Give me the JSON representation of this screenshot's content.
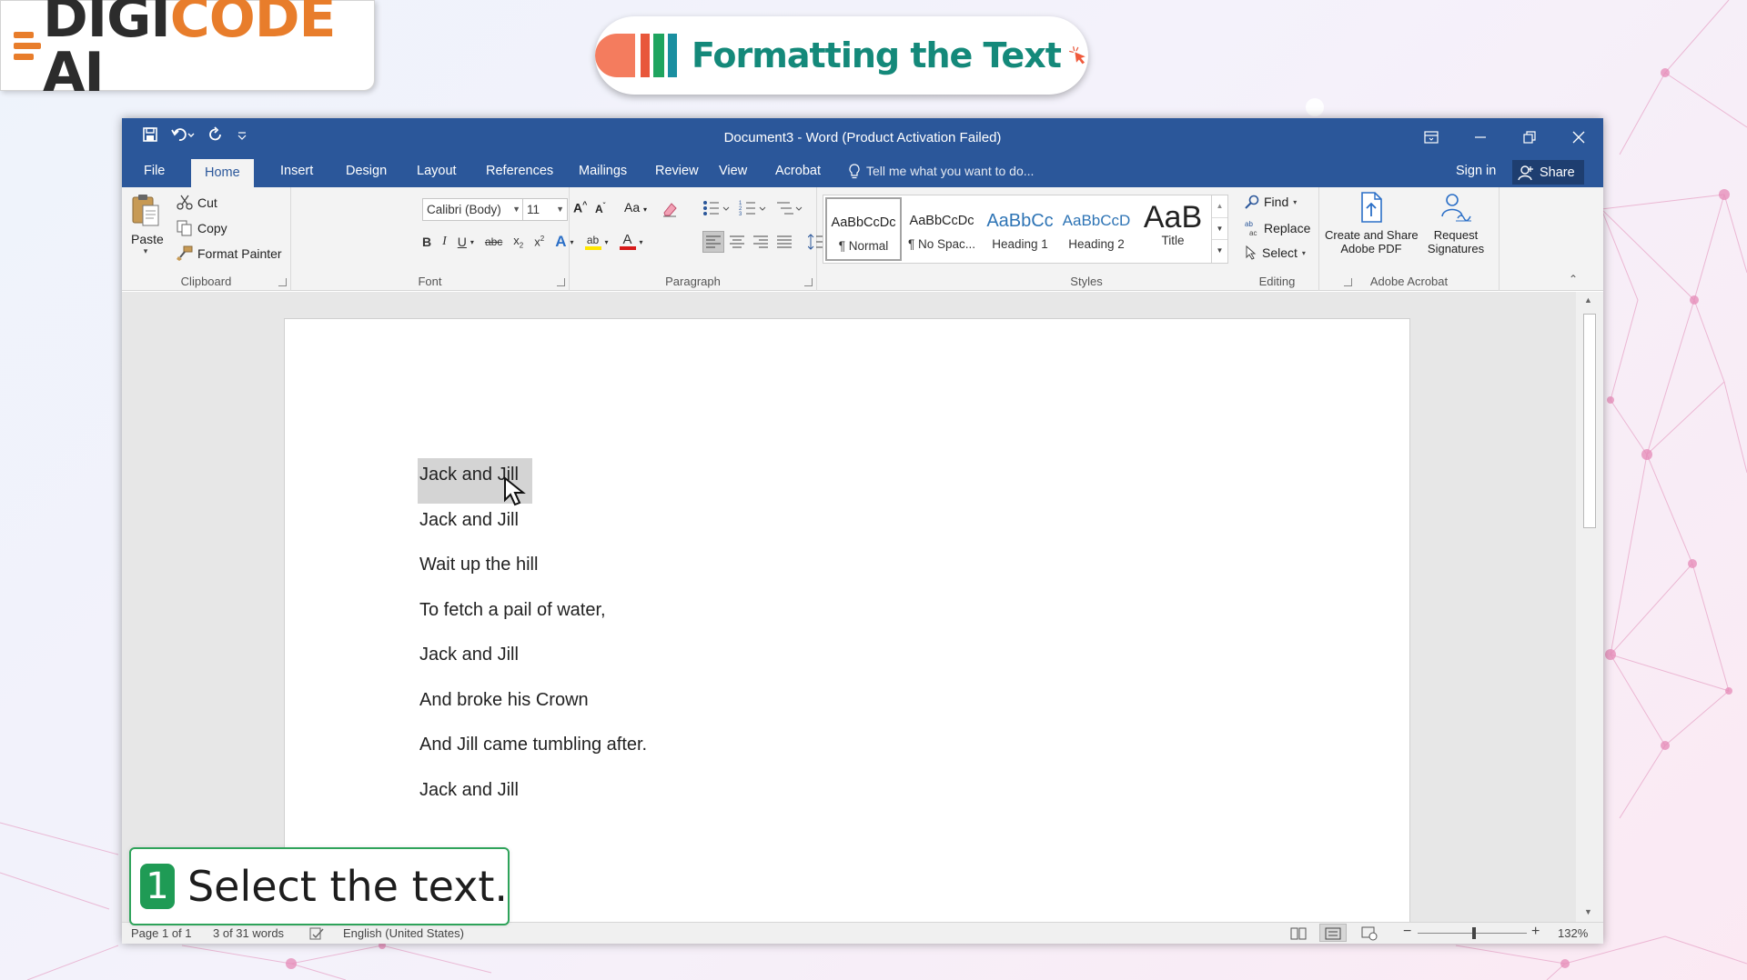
{
  "brand": {
    "logo_part1": "DIGI",
    "logo_part2": "CODE",
    "logo_part3": " AI",
    "accent": "#e87d2b"
  },
  "lesson_title": "Formatting the Text",
  "window": {
    "title": "Document3 - Word (Product Activation Failed)",
    "tabs": [
      "File",
      "Home",
      "Insert",
      "Design",
      "Layout",
      "References",
      "Mailings",
      "Review",
      "View",
      "Acrobat"
    ],
    "active_tab": "Home",
    "tell_me_placeholder": "Tell me what you want to do...",
    "sign_in": "Sign in",
    "share": "Share",
    "theme_color": "#2b579a"
  },
  "ribbon": {
    "clipboard": {
      "paste": "Paste",
      "cut": "Cut",
      "copy": "Copy",
      "format_painter": "Format Painter",
      "label": "Clipboard"
    },
    "font": {
      "font_name": "Calibri (Body)",
      "font_size": "11",
      "change_case": "Aa",
      "label": "Font"
    },
    "paragraph": {
      "label": "Paragraph"
    },
    "styles": {
      "items": [
        {
          "sample": "AaBbCcDc",
          "name": "¶ Normal"
        },
        {
          "sample": "AaBbCcDc",
          "name": "¶ No Spac..."
        },
        {
          "sample": "AaBbCc",
          "name": "Heading 1"
        },
        {
          "sample": "AaBbCcD",
          "name": "Heading 2"
        },
        {
          "sample": "AaB",
          "name": "Title"
        }
      ],
      "label": "Styles"
    },
    "editing": {
      "find": "Find",
      "replace": "Replace",
      "select": "Select",
      "label": "Editing"
    },
    "acrobat": {
      "create_share_1": "Create and Share",
      "create_share_2": "Adobe PDF",
      "request_1": "Request",
      "request_2": "Signatures",
      "label": "Adobe Acrobat"
    }
  },
  "document": {
    "lines": [
      "Jack and Jill",
      "Jack and Jill",
      "Wait up the hill",
      "To fetch a pail of water,",
      "Jack and Jill",
      "And broke his Crown",
      "And Jill came tumbling after.",
      "Jack and Jill"
    ],
    "selected_line": "Jack and Jill"
  },
  "status": {
    "page": "Page 1 of 1",
    "words": "3 of 31 words",
    "language": "English (United States)",
    "zoom": "132%"
  },
  "step": {
    "number": "1",
    "text": "Select the text."
  }
}
